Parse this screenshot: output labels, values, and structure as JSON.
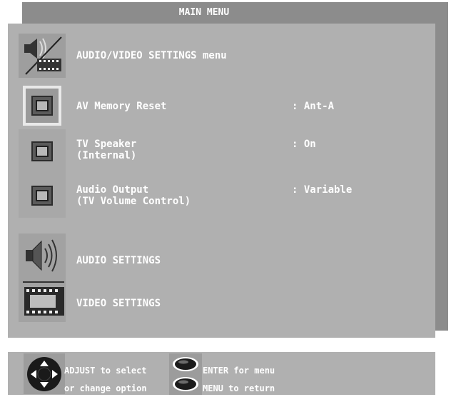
{
  "title": "MAIN MENU",
  "menu": {
    "header": {
      "label": "AUDIO/VIDEO SETTINGS menu",
      "icon": "audio-video-icon"
    },
    "items": [
      {
        "label": "AV Memory Reset",
        "value": ": Ant-A",
        "selected": true
      },
      {
        "label": "TV Speaker\n(Internal)",
        "value": ": On",
        "selected": false
      },
      {
        "label": "Audio Output\n(TV Volume Control)",
        "value": ": Variable",
        "selected": false
      }
    ],
    "submenus": [
      {
        "label": "AUDIO SETTINGS",
        "icon": "speaker-icon"
      },
      {
        "label": "VIDEO SETTINGS",
        "icon": "film-strip-icon"
      }
    ]
  },
  "footer": {
    "adjust_hint": "ADJUST to select",
    "change_hint": "or change option",
    "enter_hint": "ENTER for menu",
    "menu_hint": "MENU to return",
    "icons": [
      "dpad-icon",
      "enter-button-icon",
      "menu-button-icon"
    ]
  },
  "colors": {
    "panel": "#b0b0b0",
    "frame": "#8c8c8c",
    "text": "#ffffff",
    "highlight": "#e9e9e9"
  }
}
